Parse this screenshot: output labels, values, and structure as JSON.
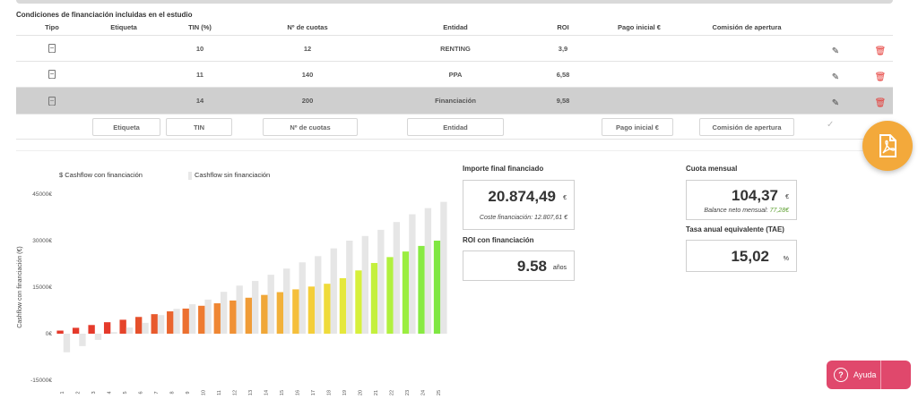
{
  "section_title": "Condiciones de financiación incluidas en el estudio",
  "table": {
    "headers": [
      "Tipo",
      "Etiqueta",
      "TIN (%)",
      "Nº de cuotas",
      "Entidad",
      "ROI",
      "Pago inicial €",
      "Comisión de apertura"
    ],
    "rows": [
      {
        "etiqueta": "",
        "tin": "10",
        "cuotas": "12",
        "entidad": "RENTING",
        "roi": "3,9",
        "pago": "",
        "comision": ""
      },
      {
        "etiqueta": "",
        "tin": "11",
        "cuotas": "140",
        "entidad": "PPA",
        "roi": "6,58",
        "pago": "",
        "comision": ""
      },
      {
        "etiqueta": "",
        "tin": "14",
        "cuotas": "200",
        "entidad": "Financiación",
        "roi": "9,58",
        "pago": "",
        "comision": ""
      }
    ],
    "new_row_placeholders": {
      "etiqueta": "Etiqueta",
      "tin": "TIN",
      "cuotas": "Nº de cuotas",
      "entidad": "Entidad",
      "pago": "Pago inicial €",
      "comision": "Comisión de apertura"
    }
  },
  "legend": {
    "with": "$ Cashflow con financiación",
    "without": "Cashflow sin financiación"
  },
  "summary": {
    "importe_label": "Importe final financiado",
    "importe_value": "20.874,49",
    "importe_unit": "€",
    "coste_text": "Coste financiación: 12.807,61 €",
    "roi_label": "ROI con financiación",
    "roi_value": "9.58",
    "roi_unit": "años",
    "cuota_label": "Cuota mensual",
    "cuota_value": "104,37",
    "cuota_unit": "€",
    "balance_label": "Balance neto mensual:",
    "balance_value": "77,28€",
    "tae_label": "Tasa anual equivalente (TAE)",
    "tae_value": "15,02",
    "tae_unit": "%"
  },
  "help_button": "Ayuda",
  "colors": {
    "accent_pdf": "#f3a93b",
    "help": "#e0486c",
    "delete": "#e53935"
  },
  "chart_data": {
    "type": "bar",
    "ylabel": "Cashflow con financiación (€)",
    "ylim": [
      -15000,
      45000
    ],
    "yticks": [
      "45000€",
      "30000€",
      "15000€",
      "0€",
      "-15000€"
    ],
    "ytick_values": [
      45000,
      30000,
      15000,
      0,
      -15000
    ],
    "categories": [
      "1",
      "2",
      "3",
      "4",
      "5",
      "6",
      "7",
      "8",
      "9",
      "10",
      "11",
      "12",
      "13",
      "14",
      "15",
      "16",
      "17",
      "18",
      "19",
      "20",
      "21",
      "22",
      "23",
      "24",
      "25"
    ],
    "series": [
      {
        "name": "$ Cashflow con financiación",
        "values": [
          1000,
          1900,
          2800,
          3700,
          4500,
          5400,
          6300,
          7200,
          8100,
          9000,
          9800,
          10700,
          11600,
          12500,
          13400,
          14300,
          15200,
          16100,
          17900,
          20400,
          22800,
          24700,
          26500,
          28300,
          30000
        ]
      },
      {
        "name": "Cashflow sin financiación",
        "values": [
          -6000,
          -4000,
          -2000,
          500,
          2000,
          3500,
          6000,
          8000,
          9500,
          11000,
          13500,
          15500,
          17000,
          19000,
          21000,
          23000,
          25000,
          27500,
          30000,
          31500,
          33500,
          36000,
          38500,
          40500,
          42500
        ]
      }
    ],
    "bar_colors_with": [
      "#e53a2b",
      "#e53a2b",
      "#e53a2b",
      "#e53a2b",
      "#e5442b",
      "#e5502b",
      "#e85a2d",
      "#ea652e",
      "#ec7030",
      "#ee7b31",
      "#ef8633",
      "#f09135",
      "#f09c37",
      "#f0a738",
      "#f2b13a",
      "#f5bf3b",
      "#f4ce3a",
      "#efdb3a",
      "#e5e83b",
      "#d7f03b",
      "#c4f03d",
      "#b1f03f",
      "#9bee40",
      "#88ea42",
      "#7fe742"
    ],
    "grid": false
  }
}
